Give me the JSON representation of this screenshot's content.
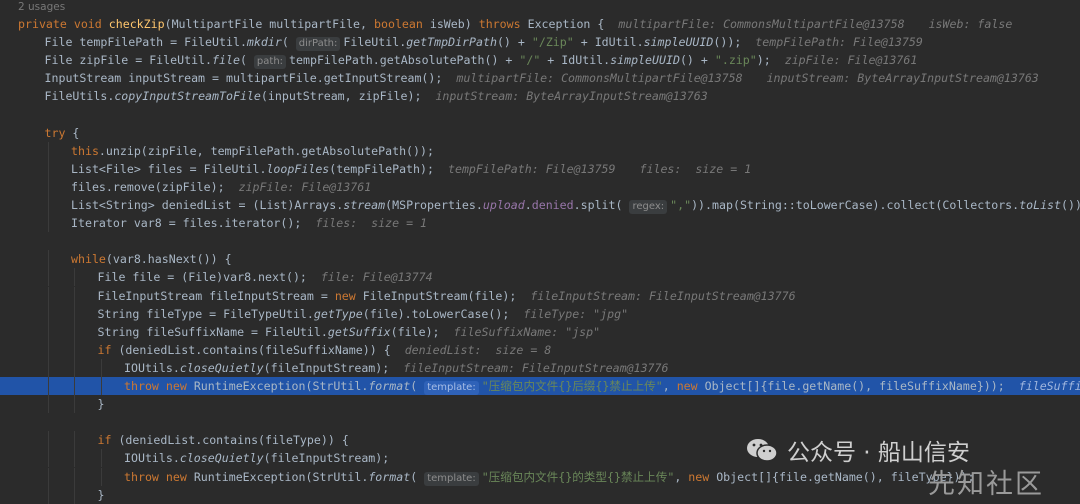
{
  "usages": "2 usages",
  "lines": [
    {
      "indent": 0,
      "parts": [
        {
          "t": "private void ",
          "c": "kw"
        },
        {
          "t": "checkZip",
          "c": "fn"
        },
        {
          "t": "(MultipartFile multipartFile, "
        },
        {
          "t": "boolean ",
          "c": "kw"
        },
        {
          "t": "isWeb) "
        },
        {
          "t": "throws ",
          "c": "kw"
        },
        {
          "t": "Exception {"
        }
      ],
      "debug": [
        "multipartFile: CommonsMultipartFile@13758",
        "isWeb: false"
      ]
    },
    {
      "indent": 1,
      "parts": [
        {
          "t": "File tempFilePath = FileUtil."
        },
        {
          "t": "mkdir",
          "c": "it"
        },
        {
          "t": "( "
        },
        {
          "t": "dirPath:",
          "c": "hint"
        },
        {
          "t": "FileUtil."
        },
        {
          "t": "getTmpDirPath",
          "c": "it"
        },
        {
          "t": "() + "
        },
        {
          "t": "\"/Zip\"",
          "c": "str"
        },
        {
          "t": " + IdUtil."
        },
        {
          "t": "simpleUUID",
          "c": "it"
        },
        {
          "t": "());"
        }
      ],
      "debug": [
        "tempFilePath: File@13759"
      ]
    },
    {
      "indent": 1,
      "parts": [
        {
          "t": "File zipFile = FileUtil."
        },
        {
          "t": "file",
          "c": "it"
        },
        {
          "t": "( "
        },
        {
          "t": "path:",
          "c": "hint"
        },
        {
          "t": "tempFilePath.getAbsolutePath() + "
        },
        {
          "t": "\"/\"",
          "c": "str"
        },
        {
          "t": " + IdUtil."
        },
        {
          "t": "simpleUUID",
          "c": "it"
        },
        {
          "t": "() + "
        },
        {
          "t": "\".zip\"",
          "c": "str"
        },
        {
          "t": ");"
        }
      ],
      "debug": [
        "zipFile: File@13761"
      ]
    },
    {
      "indent": 1,
      "parts": [
        {
          "t": "InputStream inputStream = multipartFile.getInputStream();"
        }
      ],
      "debug": [
        "multipartFile: CommonsMultipartFile@13758",
        "inputStream: ByteArrayInputStream@13763"
      ]
    },
    {
      "indent": 1,
      "parts": [
        {
          "t": "FileUtils."
        },
        {
          "t": "copyInputStreamToFile",
          "c": "it"
        },
        {
          "t": "(inputStream, zipFile);"
        }
      ],
      "debug": [
        "inputStream: ByteArrayInputStream@13763"
      ]
    },
    {
      "indent": 0,
      "parts": [],
      "debug": []
    },
    {
      "indent": 1,
      "parts": [
        {
          "t": "try ",
          "c": "kw"
        },
        {
          "t": "{"
        }
      ],
      "debug": []
    },
    {
      "indent": 2,
      "parts": [
        {
          "t": "this",
          "c": "kw"
        },
        {
          "t": ".unzip(zipFile, tempFilePath.getAbsolutePath());"
        }
      ],
      "debug": []
    },
    {
      "indent": 2,
      "parts": [
        {
          "t": "List<File> files = FileUtil."
        },
        {
          "t": "loopFiles",
          "c": "it"
        },
        {
          "t": "(tempFilePath);"
        }
      ],
      "debug": [
        "tempFilePath: File@13759",
        "files:  size = 1"
      ]
    },
    {
      "indent": 2,
      "parts": [
        {
          "t": "files.remove(zipFile);"
        }
      ],
      "debug": [
        "zipFile: File@13761"
      ]
    },
    {
      "indent": 2,
      "parts": [
        {
          "t": "List<String> deniedList = (List)Arrays."
        },
        {
          "t": "stream",
          "c": "it"
        },
        {
          "t": "(MSProperties."
        },
        {
          "t": "upload",
          "c": "fld it"
        },
        {
          "t": "."
        },
        {
          "t": "denied",
          "c": "fld"
        },
        {
          "t": ".split( "
        },
        {
          "t": "regex:",
          "c": "hint"
        },
        {
          "t": "\",\"",
          "c": "str"
        },
        {
          "t": ")).map(String::toLowerCase).collect(Collectors."
        },
        {
          "t": "toList",
          "c": "it"
        },
        {
          "t": "());"
        }
      ],
      "debug": [
        "deniedList:  size = 8"
      ]
    },
    {
      "indent": 2,
      "parts": [
        {
          "t": "Iterator var8 = files.iterator();"
        }
      ],
      "debug": [
        "files:  size = 1"
      ]
    },
    {
      "indent": 0,
      "parts": [],
      "debug": []
    },
    {
      "indent": 2,
      "parts": [
        {
          "t": "while",
          "c": "kw"
        },
        {
          "t": "(var8.hasNext()) {"
        }
      ],
      "debug": []
    },
    {
      "indent": 3,
      "parts": [
        {
          "t": "File file = (File)var8.next();"
        }
      ],
      "debug": [
        "file: File@13774"
      ]
    },
    {
      "indent": 3,
      "parts": [
        {
          "t": "FileInputStream fileInputStream = "
        },
        {
          "t": "new ",
          "c": "kw"
        },
        {
          "t": "FileInputStream(file);"
        }
      ],
      "debug": [
        "fileInputStream: FileInputStream@13776"
      ]
    },
    {
      "indent": 3,
      "parts": [
        {
          "t": "String fileType = FileTypeUtil."
        },
        {
          "t": "getType",
          "c": "it"
        },
        {
          "t": "(file).toLowerCase();"
        }
      ],
      "debug": [
        "fileType: \"jpg\""
      ]
    },
    {
      "indent": 3,
      "parts": [
        {
          "t": "String fileSuffixName = FileUtil."
        },
        {
          "t": "getSuffix",
          "c": "it"
        },
        {
          "t": "(file);"
        }
      ],
      "debug": [
        "fileSuffixName: \"jsp\""
      ]
    },
    {
      "indent": 3,
      "parts": [
        {
          "t": "if ",
          "c": "kw"
        },
        {
          "t": "(deniedList.contains(fileSuffixName)) {"
        }
      ],
      "debug": [
        "deniedList:  size = 8"
      ]
    },
    {
      "indent": 4,
      "parts": [
        {
          "t": "IOUtils."
        },
        {
          "t": "closeQuietly",
          "c": "it"
        },
        {
          "t": "(fileInputStream);"
        }
      ],
      "debug": [
        "fileInputStream: FileInputStream@13776"
      ]
    },
    {
      "indent": 4,
      "highlight": true,
      "parts": [
        {
          "t": "throw new ",
          "c": "kw"
        },
        {
          "t": "RuntimeException(StrUtil."
        },
        {
          "t": "format",
          "c": "it"
        },
        {
          "t": "( "
        },
        {
          "t": "template:",
          "c": "hint"
        },
        {
          "t": "\"压缩包内文件{}后缀{}禁止上传\"",
          "c": "str"
        },
        {
          "t": ", "
        },
        {
          "t": "new ",
          "c": "kw"
        },
        {
          "t": "Object[]{file.getName(), fileSuffixName}));"
        }
      ],
      "debug": [
        "fileSuffixName: \"js"
      ]
    },
    {
      "indent": 3,
      "parts": [
        {
          "t": "}"
        }
      ],
      "debug": []
    },
    {
      "indent": 0,
      "parts": [],
      "debug": []
    },
    {
      "indent": 3,
      "parts": [
        {
          "t": "if ",
          "c": "kw"
        },
        {
          "t": "(deniedList.contains(fileType)) {"
        }
      ],
      "debug": []
    },
    {
      "indent": 4,
      "parts": [
        {
          "t": "IOUtils."
        },
        {
          "t": "closeQuietly",
          "c": "it"
        },
        {
          "t": "(fileInputStream);"
        }
      ],
      "debug": []
    },
    {
      "indent": 4,
      "parts": [
        {
          "t": "throw new ",
          "c": "kw"
        },
        {
          "t": "RuntimeException(StrUtil."
        },
        {
          "t": "format",
          "c": "it"
        },
        {
          "t": "( "
        },
        {
          "t": "template:",
          "c": "hint"
        },
        {
          "t": "\"压缩包内文件{}的类型{}禁止上传\"",
          "c": "str"
        },
        {
          "t": ", "
        },
        {
          "t": "new ",
          "c": "kw"
        },
        {
          "t": "Object[]{file.getName(), fileType}));"
        }
      ],
      "debug": []
    },
    {
      "indent": 3,
      "parts": [
        {
          "t": "}"
        }
      ],
      "debug": []
    }
  ],
  "watermark": {
    "line1": "公众号 · 船山信安",
    "line2": "先知社区"
  },
  "colors": {
    "background": "#2b2b2b",
    "keyword": "#cc7832",
    "method": "#ffc66d",
    "string": "#6a8759",
    "field": "#9876aa",
    "highlight": "#2154a8"
  }
}
